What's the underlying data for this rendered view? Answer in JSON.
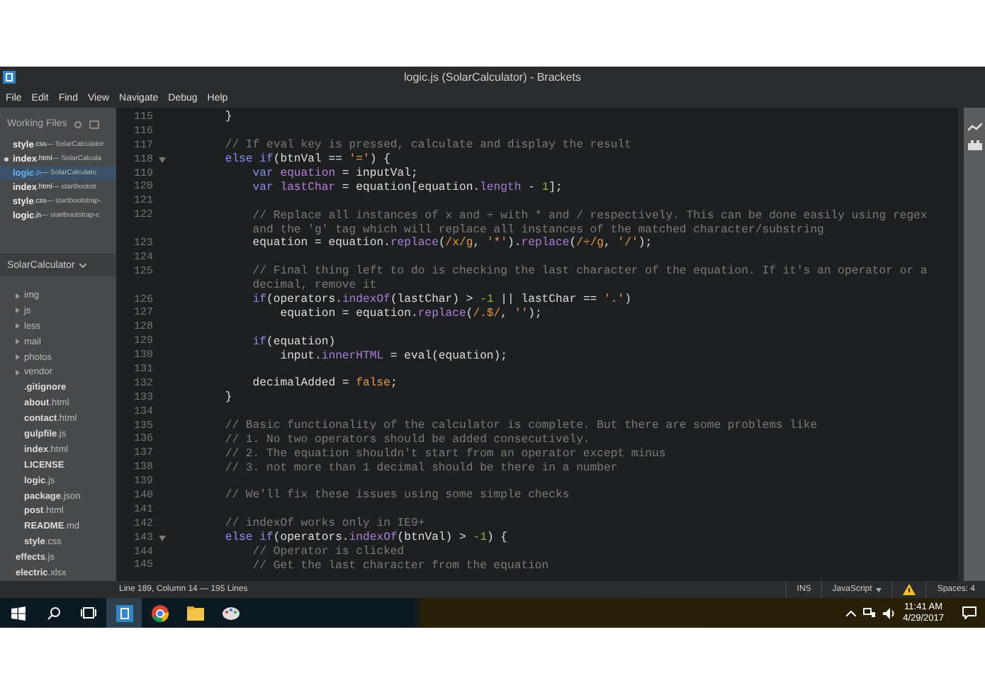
{
  "window": {
    "title": "logic.js (SolarCalculator) - Brackets"
  },
  "menu": [
    "File",
    "Edit",
    "Find",
    "View",
    "Navigate",
    "Debug",
    "Help"
  ],
  "working_files": {
    "title": "Working Files",
    "items": [
      {
        "name": "style",
        "ext": ".css",
        "project": " — SolarCalculator",
        "selected": false,
        "modified": false
      },
      {
        "name": "index",
        "ext": ".html",
        "project": " — SolarCalcula",
        "selected": false,
        "modified": true
      },
      {
        "name": "logic",
        "ext": ".js",
        "project": " — SolarCalculato",
        "selected": true,
        "modified": false
      },
      {
        "name": "index",
        "ext": ".html",
        "project": " — startbootstr",
        "selected": false,
        "modified": false
      },
      {
        "name": "style",
        "ext": ".css",
        "project": " — startbootstrap-",
        "selected": false,
        "modified": false
      },
      {
        "name": "logic",
        "ext": ".js",
        "project": " — startbootstrap-c",
        "selected": false,
        "modified": false
      }
    ]
  },
  "project": {
    "title": "SolarCalculator",
    "tree": [
      {
        "kind": "folder",
        "name": "img"
      },
      {
        "kind": "folder",
        "name": "js"
      },
      {
        "kind": "folder",
        "name": "less"
      },
      {
        "kind": "folder",
        "name": "mail"
      },
      {
        "kind": "folder",
        "name": "photos"
      },
      {
        "kind": "folder",
        "name": "vendor"
      },
      {
        "kind": "file",
        "name": ".gitignore"
      },
      {
        "kind": "file",
        "name": "about",
        "ext": ".html"
      },
      {
        "kind": "file",
        "name": "contact",
        "ext": ".html"
      },
      {
        "kind": "file",
        "name": "gulpfile",
        "ext": ".js"
      },
      {
        "kind": "file",
        "name": "index",
        "ext": ".html"
      },
      {
        "kind": "file",
        "name": "LICENSE"
      },
      {
        "kind": "file",
        "name": "logic",
        "ext": ".js"
      },
      {
        "kind": "file",
        "name": "package",
        "ext": ".json"
      },
      {
        "kind": "file",
        "name": "post",
        "ext": ".html"
      },
      {
        "kind": "file",
        "name": "README",
        "ext": ".md"
      },
      {
        "kind": "file",
        "name": "style",
        "ext": ".css"
      }
    ],
    "after": [
      {
        "name": "effects",
        "ext": ".js"
      },
      {
        "name": "electric",
        "ext": ".xlsx"
      }
    ]
  },
  "code": [
    {
      "n": "115",
      "fold": false,
      "segs": [
        {
          "color": "#dddddd",
          "t": "        }"
        }
      ]
    },
    {
      "n": "116",
      "fold": false
    },
    {
      "n": "117",
      "fold": false,
      "segs": [
        {
          "color": "#7b7b7b",
          "t": "        // If eval key is pressed, calculate and display the result"
        }
      ]
    },
    {
      "n": "118",
      "fold": true,
      "segs": [
        {
          "color": "#8a8ff0",
          "t": "        else if"
        },
        {
          "color": "#dddddd",
          "t": "(btnVal == "
        },
        {
          "color": "#e29a42",
          "t": "'='"
        },
        {
          "color": "#dddddd",
          "t": ") {"
        }
      ]
    },
    {
      "n": "119",
      "fold": false,
      "segs": [
        {
          "color": "#8a8ff0",
          "t": "            var"
        },
        {
          "color": "#b77fdb",
          "t": " equation"
        },
        {
          "color": "#dddddd",
          "t": " = inputVal;"
        }
      ]
    },
    {
      "n": "120",
      "fold": false,
      "segs": [
        {
          "color": "#8a8ff0",
          "t": "            var"
        },
        {
          "color": "#b77fdb",
          "t": " lastChar"
        },
        {
          "color": "#dddddd",
          "t": " = equation[equation."
        },
        {
          "color": "#a97fd8",
          "t": "length"
        },
        {
          "color": "#dddddd",
          "t": " - "
        },
        {
          "color": "#8fb33f",
          "t": "1"
        },
        {
          "color": "#dddddd",
          "t": "];"
        }
      ]
    },
    {
      "n": "121",
      "fold": false
    },
    {
      "n": "122",
      "fold": false,
      "segs": [
        {
          "color": "#7b7b7b",
          "t": "            // Replace all instances of x and ÷ with * and / respectively. This can be done easily using regex"
        }
      ],
      "cont": [
        {
          "color": "#7b7b7b",
          "t": "            and the 'g' tag which will replace all instances of the matched character/substring"
        }
      ]
    },
    {
      "n": "123",
      "fold": false,
      "segs": [
        {
          "color": "#dddddd",
          "t": "            equation = equation."
        },
        {
          "color": "#a97fd8",
          "t": "replace"
        },
        {
          "color": "#dddddd",
          "t": "("
        },
        {
          "color": "#e29a42",
          "t": "/x/g"
        },
        {
          "color": "#dddddd",
          "t": ", "
        },
        {
          "color": "#e29a42",
          "t": "'*'"
        },
        {
          "color": "#dddddd",
          "t": ")."
        },
        {
          "color": "#a97fd8",
          "t": "replace"
        },
        {
          "color": "#dddddd",
          "t": "("
        },
        {
          "color": "#e29a42",
          "t": "/÷/g"
        },
        {
          "color": "#dddddd",
          "t": ", "
        },
        {
          "color": "#e29a42",
          "t": "'/'"
        },
        {
          "color": "#dddddd",
          "t": ");"
        }
      ]
    },
    {
      "n": "124",
      "fold": false
    },
    {
      "n": "125",
      "fold": false,
      "segs": [
        {
          "color": "#7b7b7b",
          "t": "            // Final thing left to do is checking the last character of the equation. If it's an operator or a"
        }
      ],
      "cont": [
        {
          "color": "#7b7b7b",
          "t": "            decimal, remove it"
        }
      ]
    },
    {
      "n": "126",
      "fold": false,
      "segs": [
        {
          "color": "#8a8ff0",
          "t": "            if"
        },
        {
          "color": "#dddddd",
          "t": "(operators."
        },
        {
          "color": "#a97fd8",
          "t": "indexOf"
        },
        {
          "color": "#dddddd",
          "t": "(lastChar) > "
        },
        {
          "color": "#8fb33f",
          "t": "-1"
        },
        {
          "color": "#dddddd",
          "t": " || lastChar == "
        },
        {
          "color": "#e29a42",
          "t": "'.'"
        },
        {
          "color": "#dddddd",
          "t": ")"
        }
      ]
    },
    {
      "n": "127",
      "fold": false,
      "segs": [
        {
          "color": "#dddddd",
          "t": "                equation = equation."
        },
        {
          "color": "#a97fd8",
          "t": "replace"
        },
        {
          "color": "#dddddd",
          "t": "("
        },
        {
          "color": "#e29a42",
          "t": "/.$/"
        },
        {
          "color": "#dddddd",
          "t": ", "
        },
        {
          "color": "#e29a42",
          "t": "''"
        },
        {
          "color": "#dddddd",
          "t": ");"
        }
      ]
    },
    {
      "n": "128",
      "fold": false
    },
    {
      "n": "129",
      "fold": false,
      "segs": [
        {
          "color": "#8a8ff0",
          "t": "            if"
        },
        {
          "color": "#dddddd",
          "t": "(equation)"
        }
      ]
    },
    {
      "n": "130",
      "fold": false,
      "segs": [
        {
          "color": "#dddddd",
          "t": "                input."
        },
        {
          "color": "#a97fd8",
          "t": "innerHTML"
        },
        {
          "color": "#dddddd",
          "t": " = eval(equation);"
        }
      ]
    },
    {
      "n": "131",
      "fold": false
    },
    {
      "n": "132",
      "fold": false,
      "segs": [
        {
          "color": "#dddddd",
          "t": "            decimalAdded = "
        },
        {
          "color": "#e29a42",
          "t": "false"
        },
        {
          "color": "#dddddd",
          "t": ";"
        }
      ]
    },
    {
      "n": "133",
      "fold": false,
      "segs": [
        {
          "color": "#dddddd",
          "t": "        }"
        }
      ]
    },
    {
      "n": "134",
      "fold": false
    },
    {
      "n": "135",
      "fold": false,
      "segs": [
        {
          "color": "#7b7b7b",
          "t": "        // Basic functionality of the calculator is complete. But there are some problems like"
        }
      ]
    },
    {
      "n": "136",
      "fold": false,
      "segs": [
        {
          "color": "#7b7b7b",
          "t": "        // 1. No two operators should be added consecutively."
        }
      ]
    },
    {
      "n": "137",
      "fold": false,
      "segs": [
        {
          "color": "#7b7b7b",
          "t": "        // 2. The equation shouldn't start from an operator except minus"
        }
      ]
    },
    {
      "n": "138",
      "fold": false,
      "segs": [
        {
          "color": "#7b7b7b",
          "t": "        // 3. not more than 1 decimal should be there in a number"
        }
      ]
    },
    {
      "n": "139",
      "fold": false
    },
    {
      "n": "140",
      "fold": false,
      "segs": [
        {
          "color": "#7b7b7b",
          "t": "        // We'll fix these issues using some simple checks"
        }
      ]
    },
    {
      "n": "141",
      "fold": false
    },
    {
      "n": "142",
      "fold": false,
      "segs": [
        {
          "color": "#7b7b7b",
          "t": "        // indexOf works only in IE9+"
        }
      ]
    },
    {
      "n": "143",
      "fold": true,
      "segs": [
        {
          "color": "#8a8ff0",
          "t": "        else if"
        },
        {
          "color": "#dddddd",
          "t": "(operators."
        },
        {
          "color": "#a97fd8",
          "t": "indexOf"
        },
        {
          "color": "#dddddd",
          "t": "(btnVal) > "
        },
        {
          "color": "#8fb33f",
          "t": "-1"
        },
        {
          "color": "#dddddd",
          "t": ") {"
        }
      ]
    },
    {
      "n": "144",
      "fold": false,
      "segs": [
        {
          "color": "#7b7b7b",
          "t": "            // Operator is clicked"
        }
      ]
    },
    {
      "n": "145",
      "fold": false,
      "segs": [
        {
          "color": "#7b7b7b",
          "t": "            // Get the last character from the equation"
        }
      ]
    }
  ],
  "status_bar": {
    "position": "Line 189, Column 14 — 195 Lines",
    "mode": "INS",
    "language": "JavaScript",
    "spaces": "Spaces: 4"
  },
  "taskbar": {
    "time": "11:41 AM",
    "date": "4/29/2017"
  }
}
